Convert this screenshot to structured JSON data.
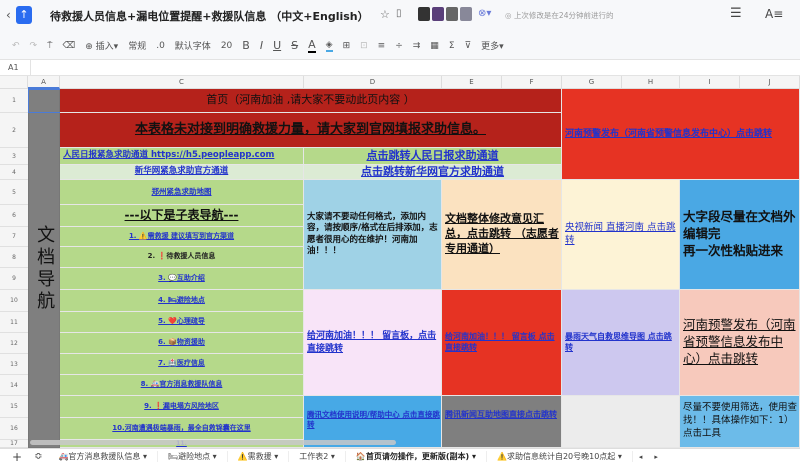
{
  "title_bar": {
    "title": "待救援人员信息+漏电位置提醒+救援队信息 （中文+English）",
    "save_status": "上次修改是在24分钟前进行的"
  },
  "toolbar": {
    "insert": "插入",
    "format": "常规",
    "decimal": ".0",
    "font": "默认字体",
    "font_size": "20",
    "bold": "B",
    "italic": "I",
    "underline": "U",
    "strike": "S",
    "text_color": "A",
    "more": "更多"
  },
  "formula_bar": {
    "cell_ref": "A1"
  },
  "columns": [
    "A",
    "C",
    "D",
    "E",
    "F",
    "G",
    "H",
    "I",
    "J"
  ],
  "rows": [
    "1",
    "2",
    "3",
    "4",
    "5",
    "6",
    "7",
    "8",
    "9",
    "10",
    "11",
    "12",
    "13",
    "14",
    "15",
    "16",
    "17"
  ],
  "cells": {
    "a_nav": "文档导航",
    "r1": "首页（河南加油 ,请大家不要动此页内容 ）",
    "r2": "本表格未对接到明确救援力量，请大家到官网填报求助信息。",
    "g1": "河南预警发布（河南省预警信息发布中心）点击跳转",
    "c3": "人民日报紧急求助通道   https://h5.peopleapp.com",
    "d3": "点击跳转人民日报求助通道",
    "c4": "新华网紧急求助官方通道",
    "d4": "点击跳转新华网官方求助通道",
    "c5": "郑州紧急求助地图",
    "c6": "---以下是子表导航---",
    "c7": "1. ⚠️需救援 建议填写到官方渠道",
    "c8": "2. ❗待救援人员信息",
    "c9": "3. 💬互助介绍",
    "c10": "4. 🛏避险地点",
    "c11": "5. ❤️心理疏导",
    "c12": "6. 📦物资援助",
    "c13": "7. 🏥医疗信息",
    "c14": "8. 🚑官方消息救援队信息",
    "c15": "9. ❗漏电塌方风险地区",
    "c16": "10.河南遭遇极端暴雨，最全自救锦囊在这里",
    "c17": "11.",
    "d5": "大家请不要动任何格式，添加内容，请按顺序/格式在后排添加，志愿者很用心的在维护！河南加油！！！",
    "e5": "文档整体修改意见汇总，点击跳转 （志愿者专用通道）",
    "g5": "央视新闻 直播河南 点击跳转",
    "i5": "大字段尽量在文档外编辑完\n再一次性粘贴进来",
    "d10": "给河南加油！！！ 留言板，点击直接跳转",
    "e10": "给河南加油！！！ 留言板 点击直接跳转",
    "g10": "暴雨天气自救思维导图 点击跳转",
    "i10": "河南预警发布（河南省预警信息发布中心）点击跳转",
    "d15": "腾讯文档使用说明/帮助中心 点击直接跳转",
    "e15": "腾讯新闻互助地图直接点击跳转",
    "i15": "尽量不要使用筛选，使用查找！！具体操作如下：1）点击工具"
  },
  "sheet_tabs": [
    "🚑官方消息救援队信息",
    "🛏避险地点",
    "⚠️需救援",
    "工作表2",
    "🏠首页请勿操作，更新版(副本)",
    "⚠️求助信息统计自20号晚10点起"
  ],
  "active_tab": 4,
  "colors": {
    "dark_red": "#b5221b",
    "red": "#e63323",
    "green": "#b5d98a",
    "light_green": "#dcebd4",
    "gray": "#7f7f7f",
    "sky": "#9fd2e6",
    "peach": "#fbe2c0",
    "cream": "#fdf3d6",
    "blue": "#4aa8e4",
    "pink": "#f8e4f8",
    "lavender": "#cdc8ef",
    "salmon": "#f7c9bc",
    "mid_blue": "#47a9e6",
    "light_blue": "#6cbbe9",
    "link": "#2233cc"
  }
}
